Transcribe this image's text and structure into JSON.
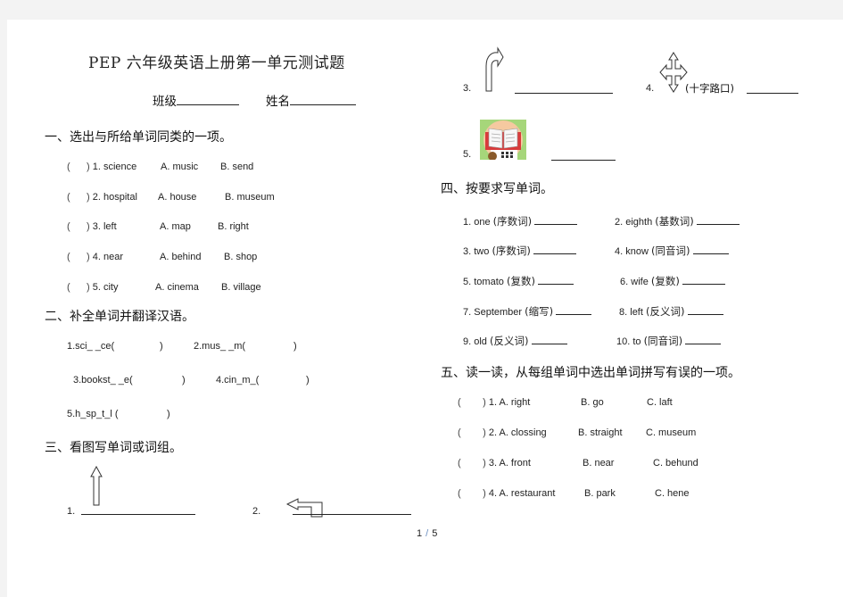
{
  "document": {
    "title": "PEP 六年级英语上册第一单元测试题",
    "class_label": "班级",
    "name_label": "姓名"
  },
  "section1": {
    "heading": "一、选出与所给单词同类的一项。",
    "items": [
      {
        "num": "1.",
        "word": "science",
        "a": "A.  music",
        "b": "B.  send"
      },
      {
        "num": "2.",
        "word": "hospital",
        "a": "A.  house",
        "b": "B.  museum"
      },
      {
        "num": "3.",
        "word": "left",
        "a": "A.  map",
        "b": "B.  right"
      },
      {
        "num": "4.",
        "word": "near",
        "a": "A.  behind",
        "b": "B.  shop"
      },
      {
        "num": "5.",
        "word": "city",
        "a": "A.  cinema",
        "b": "B.  village"
      }
    ]
  },
  "section2": {
    "heading": "二、补全单词并翻译汉语。",
    "items": [
      {
        "text": "1.sci_ _ce(",
        "close": ")"
      },
      {
        "text": "2.mus_ _m(",
        "close": ")"
      },
      {
        "text": "3.bookst_ _e(",
        "close": ")"
      },
      {
        "text": "4.cin_m_(",
        "close": ")"
      },
      {
        "text": "5.h_sp_t_l  (",
        "close": ")"
      }
    ]
  },
  "section3": {
    "heading": "三、看图写单词或词组。",
    "items": [
      {
        "num": "1.",
        "icon": "up-arrow-icon"
      },
      {
        "num": "2.",
        "icon": "turn-left-arrow-icon"
      },
      {
        "num": "3.",
        "icon": "turn-right-arrow-icon"
      },
      {
        "num": "4.",
        "icon": "crossroads-arrow-icon",
        "hint": "(十字路口)"
      },
      {
        "num": "5.",
        "icon": "library-book-icon"
      }
    ]
  },
  "section4": {
    "heading": "四、按要求写单词。",
    "items": [
      {
        "num": "1.",
        "word": "one",
        "req": "(序数词)"
      },
      {
        "num": "2.",
        "word": "eighth",
        "req": "(基数词)"
      },
      {
        "num": "3.",
        "word": "two",
        "req": "(序数词)"
      },
      {
        "num": "4.",
        "word": "know",
        "req": "(同音词)"
      },
      {
        "num": "5.",
        "word": "tomato",
        "req": "(复数)"
      },
      {
        "num": "6.",
        "word": "wife",
        "req": "(复数)"
      },
      {
        "num": "7.",
        "word": "September",
        "req": "(缩写)"
      },
      {
        "num": "8.",
        "word": "left",
        "req": "(反义词)"
      },
      {
        "num": "9.",
        "word": "old",
        "req": "(反义词)"
      },
      {
        "num": "10.",
        "word": "to",
        "req": "(同音词)"
      }
    ]
  },
  "section5": {
    "heading": "五、读一读，从每组单词中选出单词拼写有误的一项。",
    "items": [
      {
        "num": "1.",
        "a": "A.  right",
        "b": "B.  go",
        "c": "C.  laft"
      },
      {
        "num": "2.",
        "a": "A.  clossing",
        "b": "B.  straight",
        "c": "C.  museum"
      },
      {
        "num": "3.",
        "a": "A.  front",
        "b": "B.  near",
        "c": "C.  behund"
      },
      {
        "num": "4.",
        "a": "A.  restaurant",
        "b": "B.  park",
        "c": "C.  hene"
      }
    ]
  },
  "pager": {
    "current": "1",
    "separator": "/",
    "total": "5"
  }
}
